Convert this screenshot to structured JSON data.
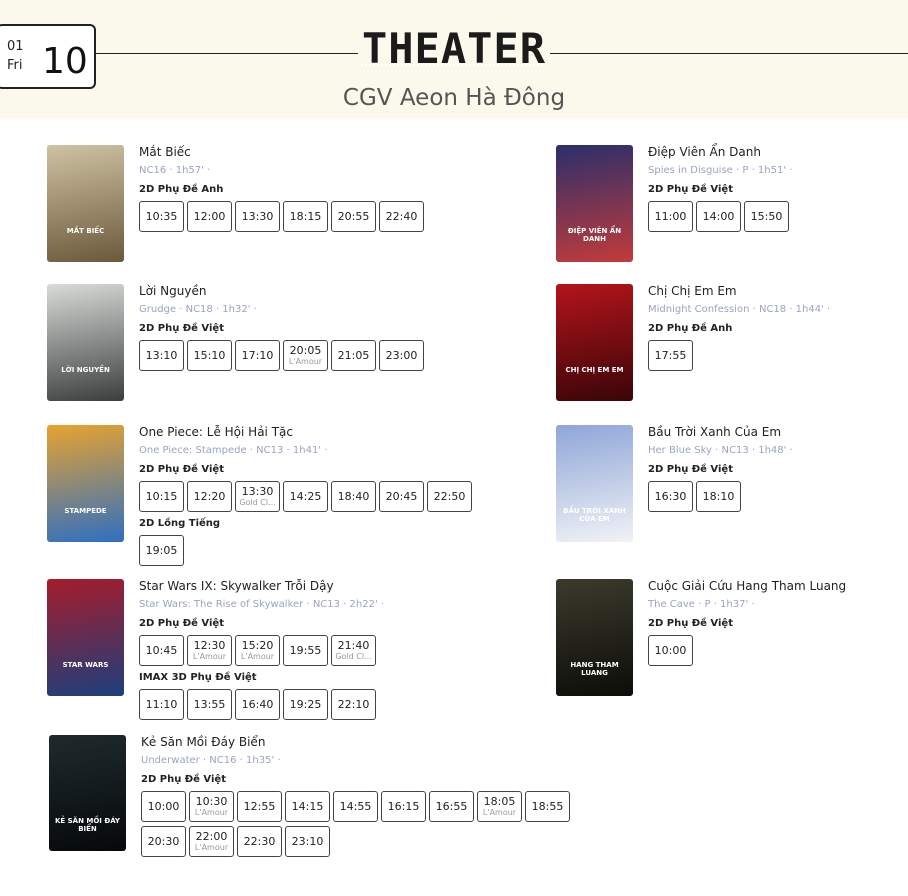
{
  "header": {
    "month": "01",
    "day_of_week": "Fri",
    "day": "10",
    "title": "THEATER",
    "cinema": "CGV Aeon Hà Đông"
  },
  "movies": [
    {
      "title": "Mắt Biếc",
      "meta": "NC16 · 1h57' ·",
      "poster_text": "MẮT BIẾC",
      "poster_colors": [
        "#cfc2a4",
        "#6b5a3a"
      ],
      "formats": [
        {
          "name": "2D Phụ Đề Anh",
          "times": [
            {
              "time": "10:35",
              "sub": ""
            },
            {
              "time": "12:00",
              "sub": ""
            },
            {
              "time": "13:30",
              "sub": ""
            },
            {
              "time": "18:15",
              "sub": ""
            },
            {
              "time": "20:55",
              "sub": ""
            },
            {
              "time": "22:40",
              "sub": ""
            }
          ]
        }
      ]
    },
    {
      "title": "Điệp Viên Ẩn Danh",
      "meta": "Spies in Disguise · P · 1h51' ·",
      "poster_text": "ĐIỆP VIÊN ẨN DANH",
      "poster_colors": [
        "#2a2f6b",
        "#c23b3b"
      ],
      "formats": [
        {
          "name": "2D Phụ Đề Việt",
          "times": [
            {
              "time": "11:00",
              "sub": ""
            },
            {
              "time": "14:00",
              "sub": ""
            },
            {
              "time": "15:50",
              "sub": ""
            }
          ]
        }
      ]
    },
    {
      "title": "Lời Nguyền",
      "meta": "Grudge · NC18 · 1h32' ·",
      "poster_text": "LỜI NGUYỀN",
      "poster_colors": [
        "#d9dbd8",
        "#3a3f3d"
      ],
      "formats": [
        {
          "name": "2D Phụ Đề Việt",
          "times": [
            {
              "time": "13:10",
              "sub": ""
            },
            {
              "time": "15:10",
              "sub": ""
            },
            {
              "time": "17:10",
              "sub": ""
            },
            {
              "time": "20:05",
              "sub": "L'Amour"
            },
            {
              "time": "21:05",
              "sub": ""
            },
            {
              "time": "23:00",
              "sub": ""
            }
          ]
        }
      ]
    },
    {
      "title": "Chị Chị Em Em",
      "meta": "Midnight Confession · NC18 · 1h44' ·",
      "poster_text": "CHỊ CHỊ EM EM",
      "poster_colors": [
        "#b3141b",
        "#3a0508"
      ],
      "formats": [
        {
          "name": "2D Phụ Đề Anh",
          "times": [
            {
              "time": "17:55",
              "sub": ""
            }
          ]
        }
      ]
    },
    {
      "title": "One Piece: Lễ Hội Hải Tặc",
      "meta": "One Piece: Stampede · NC13 · 1h41' ·",
      "poster_text": "STAMPEDE",
      "poster_colors": [
        "#e7a32e",
        "#2f6fc1"
      ],
      "formats": [
        {
          "name": "2D Phụ Đề Việt",
          "times": [
            {
              "time": "10:15",
              "sub": ""
            },
            {
              "time": "12:20",
              "sub": ""
            },
            {
              "time": "13:30",
              "sub": "Gold Cl..."
            },
            {
              "time": "14:25",
              "sub": ""
            },
            {
              "time": "18:40",
              "sub": ""
            },
            {
              "time": "20:45",
              "sub": ""
            },
            {
              "time": "22:50",
              "sub": ""
            }
          ]
        },
        {
          "name": "2D Lồng Tiếng",
          "times": [
            {
              "time": "19:05",
              "sub": ""
            }
          ]
        }
      ]
    },
    {
      "title": "Bầu Trời Xanh Của Em",
      "meta": "Her Blue Sky · NC13 · 1h48' ·",
      "poster_text": "BẦU TRỜI XANH CỦA EM",
      "poster_colors": [
        "#8ea6d8",
        "#f1f2f6"
      ],
      "formats": [
        {
          "name": "2D Phụ Đề Việt",
          "times": [
            {
              "time": "16:30",
              "sub": ""
            },
            {
              "time": "18:10",
              "sub": ""
            }
          ]
        }
      ]
    },
    {
      "title": "Star Wars IX: Skywalker Trỗi Dậy",
      "meta": "Star Wars: The Rise of Skywalker · NC13 · 2h22' ·",
      "poster_text": "STAR WARS",
      "poster_colors": [
        "#a51c2b",
        "#1d3f7c"
      ],
      "formats": [
        {
          "name": "2D Phụ Đề Việt",
          "times": [
            {
              "time": "10:45",
              "sub": ""
            },
            {
              "time": "12:30",
              "sub": "L'Amour"
            },
            {
              "time": "15:20",
              "sub": "L'Amour"
            },
            {
              "time": "19:55",
              "sub": ""
            },
            {
              "time": "21:40",
              "sub": "Gold Cl..."
            }
          ]
        },
        {
          "name": "IMAX 3D Phụ Đề Việt",
          "times": [
            {
              "time": "11:10",
              "sub": ""
            },
            {
              "time": "13:55",
              "sub": ""
            },
            {
              "time": "16:40",
              "sub": ""
            },
            {
              "time": "19:25",
              "sub": ""
            },
            {
              "time": "22:10",
              "sub": ""
            }
          ]
        }
      ]
    },
    {
      "title": "Cuộc Giải Cứu Hang Tham Luang",
      "meta": "The Cave · P · 1h37' ·",
      "poster_text": "HANG THAM LUANG",
      "poster_colors": [
        "#3a3a2c",
        "#0d0d0a"
      ],
      "formats": [
        {
          "name": "2D Phụ Đề Việt",
          "times": [
            {
              "time": "10:00",
              "sub": ""
            }
          ]
        }
      ]
    },
    {
      "title": "Kẻ Săn Mồi Đáy Biển",
      "meta": "Underwater · NC16 · 1h35' ·",
      "poster_text": "KẺ SĂN MỒI ĐÁY BIỂN",
      "poster_colors": [
        "#1f2a2e",
        "#06090a"
      ],
      "formats": [
        {
          "name": "2D Phụ Đề Việt",
          "times": [
            {
              "time": "10:00",
              "sub": ""
            },
            {
              "time": "10:30",
              "sub": "L'Amour"
            },
            {
              "time": "12:55",
              "sub": ""
            },
            {
              "time": "14:15",
              "sub": ""
            },
            {
              "time": "14:55",
              "sub": ""
            },
            {
              "time": "16:15",
              "sub": ""
            },
            {
              "time": "16:55",
              "sub": ""
            },
            {
              "time": "18:05",
              "sub": "L'Amour"
            },
            {
              "time": "18:55",
              "sub": ""
            },
            {
              "time": "20:30",
              "sub": ""
            },
            {
              "time": "22:00",
              "sub": "L'Amour"
            },
            {
              "time": "22:30",
              "sub": ""
            },
            {
              "time": "23:10",
              "sub": ""
            }
          ]
        }
      ]
    }
  ]
}
